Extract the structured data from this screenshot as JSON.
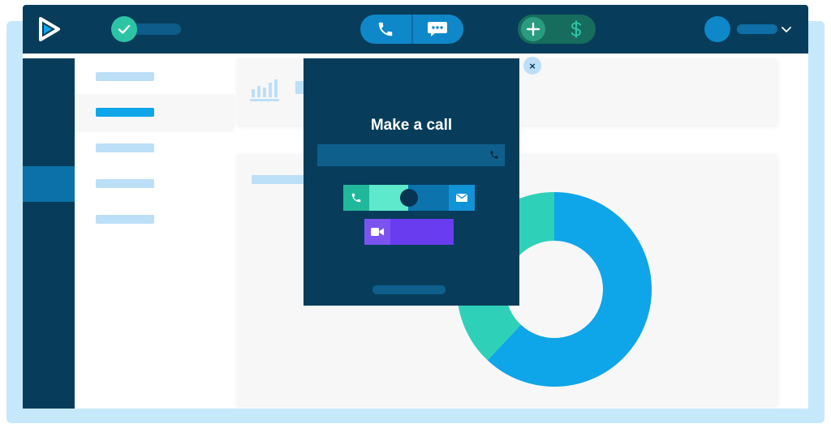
{
  "dialog": {
    "title": "Make a call",
    "number_input_value": "",
    "number_input_placeholder": "",
    "close_glyph": "×"
  },
  "icons": {
    "logo": "play-logo-icon",
    "status": "check-icon",
    "call": "phone-icon",
    "message": "chat-bubble-icon",
    "add": "plus-icon",
    "payment": "dollar-icon",
    "user_menu": "chevron-down-icon",
    "stats": "bar-chart-icon",
    "dial": "phone-icon",
    "email": "mail-icon",
    "video": "video-camera-icon",
    "close": "close-icon"
  },
  "colors": {
    "navy": "#073d5b",
    "brand_blue": "#0f88c9",
    "sky": "#0ea5e9",
    "teal": "#2ed1b8",
    "mint": "#5ee8cc",
    "purple": "#6a3cf0",
    "light_blue": "#bcdff8",
    "backdrop": "#c6e8fb"
  },
  "chart_data": {
    "type": "pie",
    "donut": true,
    "series": [
      {
        "values": [
          62,
          38
        ],
        "colors": [
          "#0ea5e9",
          "#2ed1b8"
        ]
      }
    ]
  }
}
